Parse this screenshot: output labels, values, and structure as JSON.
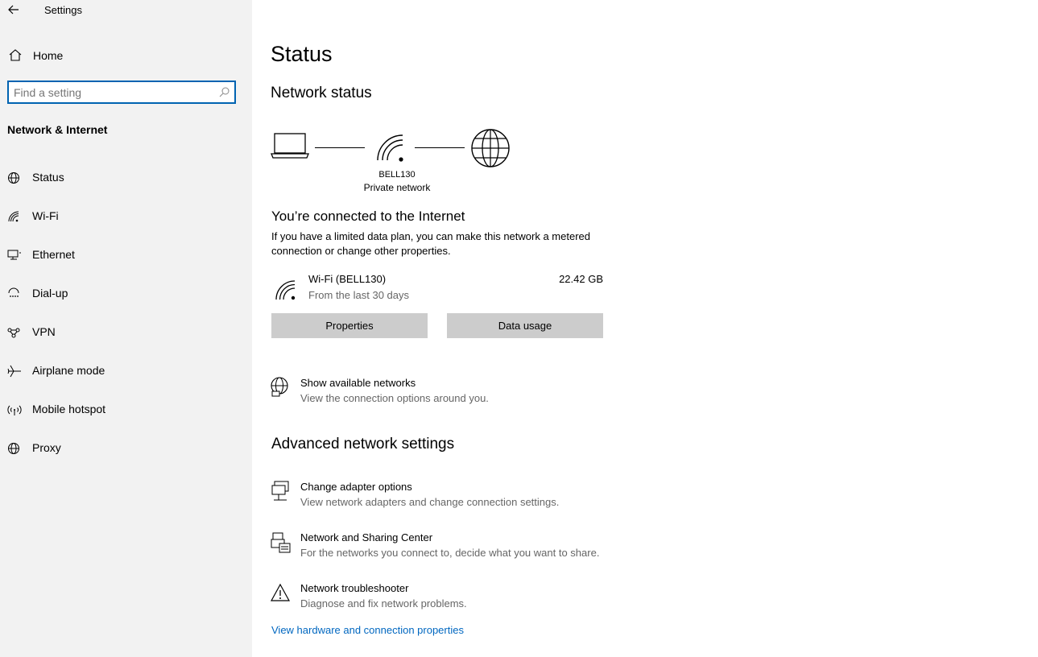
{
  "window": {
    "title": "Settings"
  },
  "sidebar": {
    "home_label": "Home",
    "search_placeholder": "Find a setting",
    "section_title": "Network & Internet",
    "items": [
      {
        "label": "Status",
        "icon": "globe-icon"
      },
      {
        "label": "Wi-Fi",
        "icon": "wifi-icon"
      },
      {
        "label": "Ethernet",
        "icon": "ethernet-icon"
      },
      {
        "label": "Dial-up",
        "icon": "dialup-icon"
      },
      {
        "label": "VPN",
        "icon": "vpn-icon"
      },
      {
        "label": "Airplane mode",
        "icon": "airplane-icon"
      },
      {
        "label": "Mobile hotspot",
        "icon": "hotspot-icon"
      },
      {
        "label": "Proxy",
        "icon": "globe-icon"
      }
    ]
  },
  "main": {
    "page_title": "Status",
    "network_status_heading": "Network status",
    "network_name": "BELL130",
    "network_type": "Private network",
    "connected_heading": "You’re connected to the Internet",
    "connected_description": "If you have a limited data plan, you can make this network a metered connection or change other properties.",
    "connection": {
      "name": "Wi-Fi (BELL130)",
      "period": "From the last 30 days",
      "usage": "22.42 GB"
    },
    "buttons": {
      "properties": "Properties",
      "data_usage": "Data usage"
    },
    "show_networks": {
      "title": "Show available networks",
      "subtitle": "View the connection options around you."
    },
    "advanced_heading": "Advanced network settings",
    "advanced_items": [
      {
        "title": "Change adapter options",
        "subtitle": "View network adapters and change connection settings.",
        "icon": "adapter-icon"
      },
      {
        "title": "Network and Sharing Center",
        "subtitle": "For the networks you connect to, decide what you want to share.",
        "icon": "sharing-icon"
      },
      {
        "title": "Network troubleshooter",
        "subtitle": "Diagnose and fix network problems.",
        "icon": "warning-icon"
      }
    ],
    "hardware_link": "View hardware and connection properties"
  },
  "colors": {
    "accent": "#0067c0",
    "sidebar_bg": "#f2f2f2",
    "button_bg": "#cccccc"
  }
}
